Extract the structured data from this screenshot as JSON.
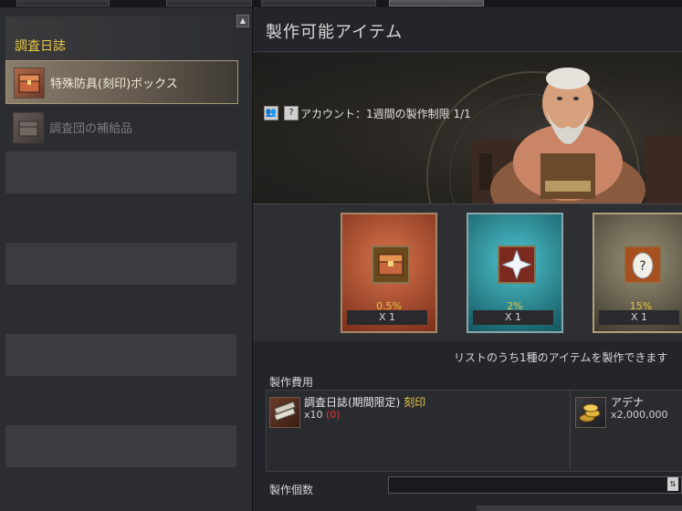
{
  "left": {
    "header_title": "調査日誌",
    "items": [
      {
        "label": "特殊防具(刻印)ボックス",
        "selected": true
      },
      {
        "label": "調査団の補給品",
        "selected": false
      }
    ]
  },
  "right": {
    "title": "製作可能アイテム",
    "limit_text": "アカウント：1週間の製作制限 1/1",
    "cards": [
      {
        "rate": "0.5%",
        "qty": "X 1",
        "icon": "treasure-chest-icon",
        "theme": "#b54a2c"
      },
      {
        "rate": "2%",
        "qty": "X 1",
        "icon": "crystal-spark-icon",
        "theme": "#1f8a95"
      },
      {
        "rate": "15%",
        "qty": "X 1",
        "icon": "mystery-egg-icon",
        "theme": "#6e6a5a"
      }
    ],
    "note": "リストのうち1種のアイテムを製作できます",
    "cost_label": "製作費用",
    "materials": [
      {
        "name": "調査日誌(期間限定)",
        "tag": "刻印",
        "qty": "x10",
        "owned": "(0)",
        "icon": "scroll-bundle-icon"
      },
      {
        "name": "アデナ",
        "qty": "x2,000,000",
        "icon": "gold-coins-icon"
      }
    ],
    "count_label": "製作個数"
  }
}
